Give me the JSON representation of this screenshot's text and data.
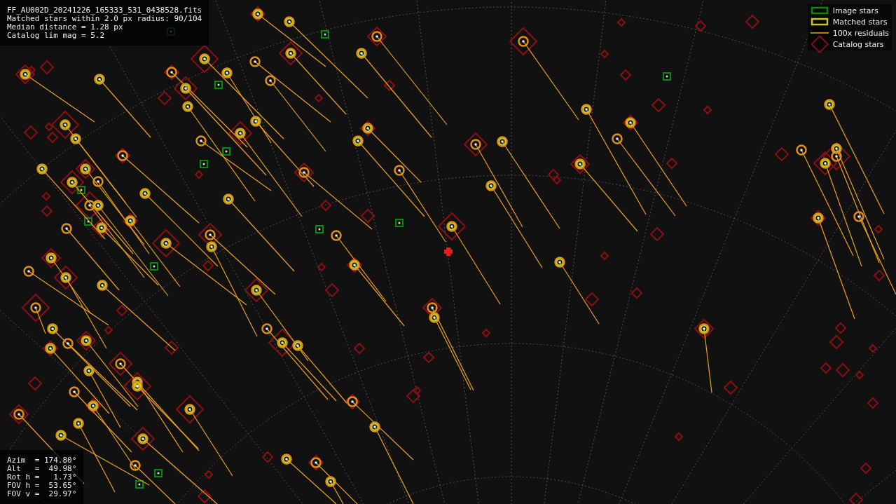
{
  "file_info": [
    "FF_AU002D_20241226_165333_531_0438528.fits",
    "Matched stars within 2.0 px radius: 90/104",
    "Median distance = 1.28 px",
    "Catalog lim mag = 5.2"
  ],
  "legend": [
    {
      "kind": "image",
      "label": "Image stars"
    },
    {
      "kind": "matched",
      "label": "Matched stars"
    },
    {
      "kind": "residual",
      "label": "100x residuals"
    },
    {
      "kind": "catalog",
      "label": "Catalog stars"
    }
  ],
  "pointing": [
    "Azim  = 174.80°",
    "Alt   =  49.98°",
    "Rot h =   1.73°",
    "FOV h =  53.65°",
    "FOV v =  29.97°"
  ]
}
